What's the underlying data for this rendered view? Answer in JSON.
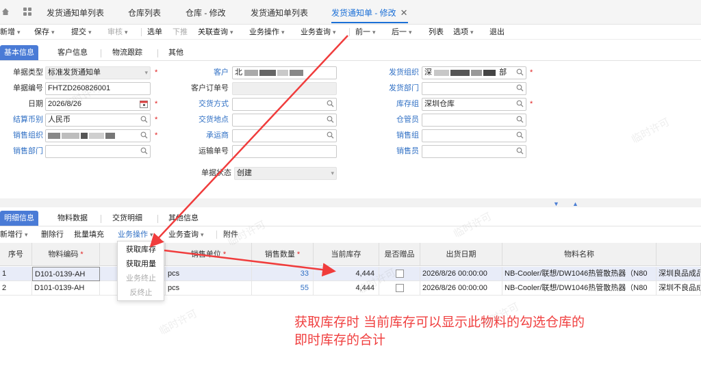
{
  "page_tabs": [
    "发货通知单列表",
    "仓库列表",
    "仓库 - 修改",
    "发货通知单列表",
    "发货通知单 - 修改"
  ],
  "toolbar": {
    "items": [
      "新增",
      "保存",
      "提交",
      "审核",
      "选单",
      "下推",
      "关联查询",
      "业务操作",
      "业务查询",
      "前一",
      "后一",
      "列表",
      "选项",
      "退出"
    ]
  },
  "header_tabs": [
    "基本信息",
    "客户信息",
    "物流跟踪",
    "其他"
  ],
  "form": {
    "labels": {
      "bill_type": "单据类型",
      "bill_no": "单据编号",
      "date": "日期",
      "currency": "结算币别",
      "sales_org": "销售组织",
      "sales_dept": "销售部门",
      "customer": "客户",
      "customer_order_no": "客户订单号",
      "delivery_method": "交货方式",
      "delivery_place": "交货地点",
      "carrier": "承运商",
      "waybill_no": "运输单号",
      "doc_status": "单据状态",
      "ship_org": "发货组织",
      "ship_dept": "发货部门",
      "stock_group": "库存组",
      "warehouse_keeper": "仓管员",
      "sales_group": "销售组",
      "salesperson": "销售员"
    },
    "values": {
      "bill_type": "标准发货通知单",
      "bill_no": "FHTZD260826001",
      "date": "2026/8/26",
      "currency": "人民币",
      "customer": "北",
      "doc_status": "创建",
      "ship_org_prefix": "深",
      "ship_org_suffix": "部",
      "stock_group": "深圳仓库"
    }
  },
  "detail_tabs": [
    "明细信息",
    "物料数据",
    "交货明细",
    "其他信息"
  ],
  "grid_toolbar": [
    "新增行",
    "删除行",
    "批量填充",
    "业务操作",
    "业务查询",
    "附件"
  ],
  "grid": {
    "columns": [
      "序号",
      "物料编码",
      "销售单位",
      "销售数量",
      "当前库存",
      "是否赠品",
      "出货日期",
      "物料名称"
    ],
    "rows": [
      {
        "seq": "1",
        "code": "D101-0139-AH",
        "unit": "pcs",
        "qty": "33",
        "stock": "4,444",
        "date": "2026/8/26 00:00:00",
        "name": "NB-Cooler/联想/DW1046热管散热器（N80",
        "stock_org": "深圳良品成品"
      },
      {
        "seq": "2",
        "code": "D101-0139-AH",
        "unit": "pcs",
        "qty": "55",
        "stock": "4,444",
        "date": "2026/8/26 00:00:00",
        "name": "NB-Cooler/联想/DW1046热管散热器（N80",
        "stock_org": "深圳不良品成品"
      }
    ]
  },
  "dropdown": {
    "items": [
      "获取库存",
      "获取用量",
      "业务终止",
      "反终止"
    ]
  },
  "annotation": {
    "line1": "获取库存时  当前库存可以显示此物料的勾选仓库的",
    "line2": "即时库存的合计"
  },
  "watermark": "临时许可",
  "colors": {
    "accent": "#1b6fd6",
    "tab_active": "#4a7bd6",
    "link": "#2f6fc4",
    "required": "#e02020",
    "annotation": "#f04040"
  }
}
